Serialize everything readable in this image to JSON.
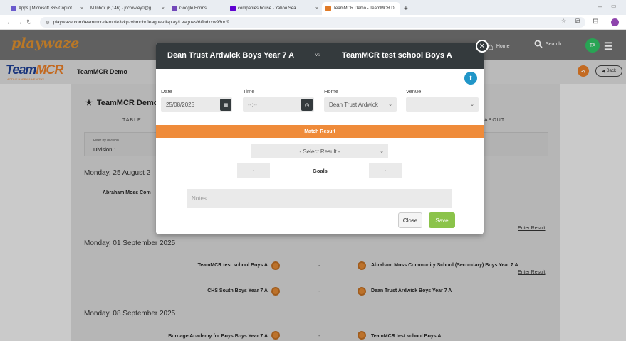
{
  "browser": {
    "tabs": [
      {
        "label": "Apps | Microsoft 365 Copilot",
        "favicon_color": "#6a5acd"
      },
      {
        "label": "M Inbox (6,146) - jdcrowley0@g...",
        "favicon_color": "#ffffff"
      },
      {
        "label": "Google Forms",
        "favicon_color": "#7248b9"
      },
      {
        "label": "companies house - Yahoo Sea...",
        "favicon_color": "#5f01d1"
      },
      {
        "label": "TeamMCR Demo - TeamMCR D...",
        "favicon_color": "#e07a27"
      }
    ],
    "new_tab": "+",
    "url": "playwaze.com/teammcr-demo/e3vkpzvhmohr/league-display/Leagues/6tfbdxxw93orf9",
    "profile_color": "#8e44ad"
  },
  "site": {
    "logo": "playwaze",
    "home_label": "Home",
    "search_label": "Search",
    "avatar_initials": "TA"
  },
  "page": {
    "logo_main": "Team",
    "logo_accent": "MCR",
    "logo_tagline": "ACTIVE HAPPY & HEALTHY",
    "org_title": "TeamMCR Demo",
    "back_label": "Back",
    "league_title": "TeamMCR Demo",
    "tab_table": "TABLE",
    "tab_about": "ABOUT",
    "filter_label": "Filter by division",
    "filter_value": "Division 1",
    "enter_result": "Enter Result",
    "date_groups": [
      {
        "date": "Monday, 25 August 2",
        "fixtures": [
          {
            "home": "Abraham Moss Com"
          }
        ]
      },
      {
        "date": "Monday, 01 September 2025",
        "fixtures": [
          {
            "home": "TeamMCR test school Boys A",
            "away": "Abraham Moss Community School (Secondary) Boys Year 7 A",
            "enter": true
          },
          {
            "home": "CHS South Boys Year 7 A",
            "away": "Dean Trust Ardwick Boys Year 7 A",
            "enter": false
          }
        ]
      },
      {
        "date": "Monday, 08 September 2025",
        "fixtures": [
          {
            "home": "Burnage Academy for Boys Boys Year 7 A",
            "away": "TeamMCR test school Boys A",
            "enter": false
          }
        ]
      }
    ],
    "dash": "-"
  },
  "modal": {
    "home_team": "Dean Trust Ardwick Boys Year 7 A",
    "vs": "vs",
    "away_team": "TeamMCR test school Boys A",
    "date_label": "Date",
    "date_value": "25/08/2025",
    "time_label": "Time",
    "time_value": "--:--",
    "home_label": "Home",
    "home_value": "Dean Trust Ardwick",
    "venue_label": "Venue",
    "venue_value": "",
    "result_header": "Match Result",
    "result_select": "- Select Result -",
    "goals_label": "Goals",
    "home_goals": "-",
    "away_goals": "-",
    "notes_placeholder": "Notes",
    "close_label": "Close",
    "save_label": "Save"
  }
}
